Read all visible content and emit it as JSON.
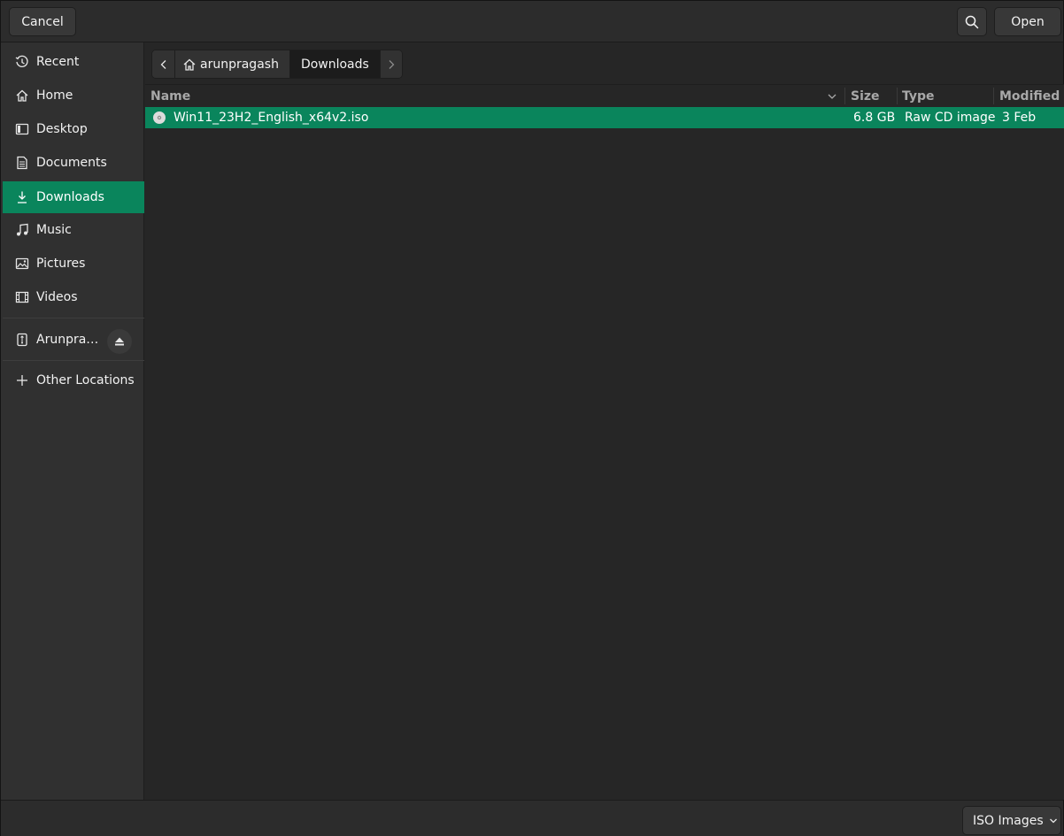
{
  "header": {
    "cancel_label": "Cancel",
    "open_label": "Open",
    "search_icon": "search-icon"
  },
  "sidebar": {
    "items": [
      {
        "label": "Recent",
        "icon": "clock-icon"
      },
      {
        "label": "Home",
        "icon": "home-icon"
      },
      {
        "label": "Desktop",
        "icon": "desktop-icon"
      },
      {
        "label": "Documents",
        "icon": "document-icon"
      },
      {
        "label": "Downloads",
        "icon": "download-icon",
        "active": true
      },
      {
        "label": "Music",
        "icon": "music-icon"
      },
      {
        "label": "Pictures",
        "icon": "picture-icon"
      },
      {
        "label": "Videos",
        "icon": "video-icon"
      }
    ],
    "drive": {
      "label": "Arunpra…",
      "icon": "usb-drive-icon",
      "eject_icon": "eject-icon"
    },
    "other_locations": {
      "label": "Other Locations",
      "icon": "plus-icon"
    }
  },
  "pathbar": {
    "segments": [
      {
        "label": "arunpragash",
        "icon": "home-icon"
      },
      {
        "label": "Downloads",
        "current": true
      }
    ]
  },
  "filelist": {
    "columns": [
      "Name",
      "Size",
      "Type",
      "Modified"
    ],
    "rows": [
      {
        "name": "Win11_23H2_English_x64v2.iso",
        "size": "6.8 GB",
        "type": "Raw CD image",
        "modified": "3 Feb",
        "icon": "disc-icon",
        "selected": true
      }
    ]
  },
  "footer": {
    "filter_label": "ISO Images"
  },
  "colors": {
    "accent": "#0a855c",
    "background": "#262626",
    "sidebar": "#303030"
  }
}
